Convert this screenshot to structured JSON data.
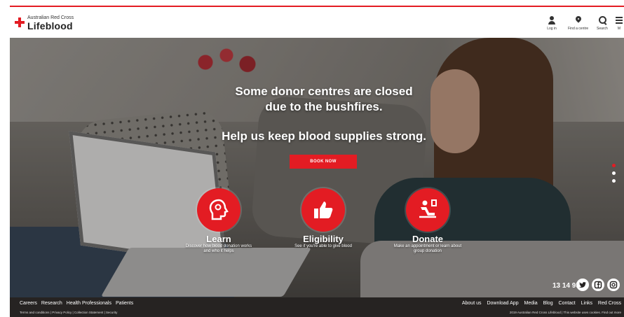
{
  "header": {
    "org": "Australian Red Cross",
    "brand": "Lifeblood",
    "utility": [
      {
        "label": "Log in",
        "icon": "user-icon"
      },
      {
        "label": "Find a centre",
        "icon": "location-pin-icon"
      },
      {
        "label": "Search",
        "icon": "search-icon"
      },
      {
        "label": "M",
        "icon": "menu-icon"
      }
    ]
  },
  "hero": {
    "headline_line1": "Some donor centres are closed",
    "headline_line2": "due to the bushfires.",
    "headline_line3": "Help us keep blood supplies strong.",
    "cta": "BOOK NOW"
  },
  "features": [
    {
      "title": "Learn",
      "desc": "Discover how blood donation works and who it helps",
      "icon": "head-icon"
    },
    {
      "title": "Eligibility",
      "desc": "See if you're able to give blood",
      "icon": "thumbs-up-icon"
    },
    {
      "title": "Donate",
      "desc": "Make an appointment or learn about group donation",
      "icon": "donor-chair-icon"
    }
  ],
  "contact": {
    "phone": "13 14 95",
    "social": [
      "twitter-icon",
      "facebook-icon",
      "instagram-icon"
    ]
  },
  "footer": {
    "left_links": [
      "Careers",
      "Research",
      "Health Professionals",
      "Patients"
    ],
    "right_links": [
      "About us",
      "Download App",
      "Media",
      "Blog",
      "Contact",
      "Links",
      "Red Cross"
    ],
    "legal": "Terms and conditions  |  Privacy Policy  |  Collection Statement  |  Security",
    "copyright": "2019 Australian Red Cross Lifeblood  |  This website uses cookies. Find out more"
  },
  "colors": {
    "accent": "#e31c23",
    "footer_bg": "#262322"
  }
}
